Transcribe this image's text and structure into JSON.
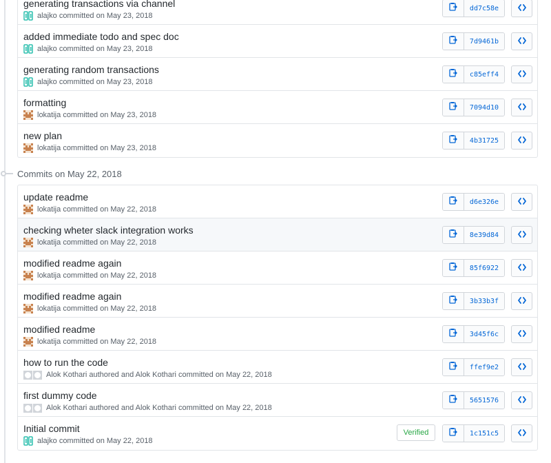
{
  "groups": [
    {
      "header": "",
      "commits": [
        {
          "title": "generating transactions via channel",
          "avatar": "dual-icon",
          "author": "alajko",
          "meta": "committed on May 23, 2018",
          "sha": "dd7c58e",
          "verified": false
        },
        {
          "title": "added immediate todo and spec doc",
          "avatar": "dual-icon",
          "author": "alajko",
          "meta": "committed on May 23, 2018",
          "sha": "7d9461b",
          "verified": false
        },
        {
          "title": "generating random transactions",
          "avatar": "dual-icon",
          "author": "alajko",
          "meta": "committed on May 23, 2018",
          "sha": "c85eff4",
          "verified": false
        },
        {
          "title": "formatting",
          "avatar": "identicon-brown",
          "author": "lokatija",
          "meta": "committed on May 23, 2018",
          "sha": "7094d10",
          "verified": false
        },
        {
          "title": "new plan",
          "avatar": "identicon-brown",
          "author": "lokatija",
          "meta": "committed on May 23, 2018",
          "sha": "4b31725",
          "verified": false
        }
      ]
    },
    {
      "header": "Commits on May 22, 2018",
      "commits": [
        {
          "title": "update readme",
          "avatar": "identicon-brown",
          "author": "lokatija",
          "meta": "committed on May 22, 2018",
          "sha": "d6e326e",
          "verified": false
        },
        {
          "title": "checking wheter slack integration works",
          "avatar": "identicon-brown",
          "author": "lokatija",
          "meta": "committed on May 22, 2018",
          "sha": "8e39d84",
          "verified": false,
          "highlight": true
        },
        {
          "title": "modified readme again",
          "avatar": "identicon-brown",
          "author": "lokatija",
          "meta": "committed on May 22, 2018",
          "sha": "85f6922",
          "verified": false
        },
        {
          "title": "modified readme again",
          "avatar": "identicon-brown",
          "author": "lokatija",
          "meta": "committed on May 22, 2018",
          "sha": "3b33b3f",
          "verified": false
        },
        {
          "title": "modified readme",
          "avatar": "identicon-brown",
          "author": "lokatija",
          "meta": "committed on May 22, 2018",
          "sha": "3d45f6c",
          "verified": false
        },
        {
          "title": "how to run the code",
          "avatar": "github-octocat-pair",
          "author": "Alok Kothari",
          "meta": "authored and Alok Kothari committed on May 22, 2018",
          "sha": "ffef9e2",
          "verified": false
        },
        {
          "title": "first dummy code",
          "avatar": "github-octocat-pair",
          "author": "Alok Kothari",
          "meta": "authored and Alok Kothari committed on May 22, 2018",
          "sha": "5651576",
          "verified": false
        },
        {
          "title": "Initial commit",
          "avatar": "dual-icon",
          "author": "alajko",
          "meta": "committed on May 22, 2018",
          "sha": "1c151c5",
          "verified": true,
          "verified_label": "Verified"
        }
      ]
    }
  ],
  "icons": {
    "copy": "clipboard-icon",
    "browse": "code-icon"
  },
  "colors": {
    "sha": "#0366d6",
    "verified": "#28a745",
    "row_highlight": "#f6f8fa"
  }
}
